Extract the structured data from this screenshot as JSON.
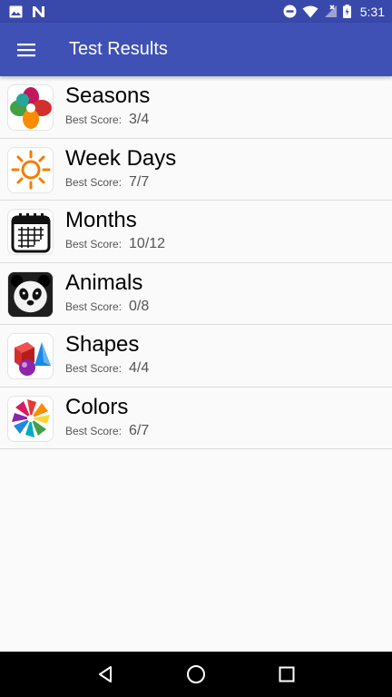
{
  "status_bar": {
    "time": "5:31",
    "left_icons": [
      "image-icon",
      "n-notification-icon"
    ],
    "right_icons": [
      "do-not-disturb-icon",
      "wifi-icon",
      "signal-off-icon",
      "battery-charging-icon"
    ]
  },
  "app_bar": {
    "title": "Test Results",
    "menu_icon": "hamburger-menu-icon",
    "color": "#3f51b5",
    "status_color": "#3949ab"
  },
  "results": {
    "score_label": "Best Score:",
    "items": [
      {
        "title": "Seasons",
        "score": "3/4",
        "icon": "seasons-flower-icon"
      },
      {
        "title": "Week Days",
        "score": "7/7",
        "icon": "sun-icon"
      },
      {
        "title": "Months",
        "score": "10/12",
        "icon": "calendar-icon"
      },
      {
        "title": "Animals",
        "score": "0/8",
        "icon": "panda-icon"
      },
      {
        "title": "Shapes",
        "score": "4/4",
        "icon": "shapes-icon"
      },
      {
        "title": "Colors",
        "score": "6/7",
        "icon": "pinwheel-icon"
      }
    ]
  },
  "nav_bar": {
    "buttons": [
      "back-icon",
      "home-icon",
      "recents-icon"
    ]
  }
}
